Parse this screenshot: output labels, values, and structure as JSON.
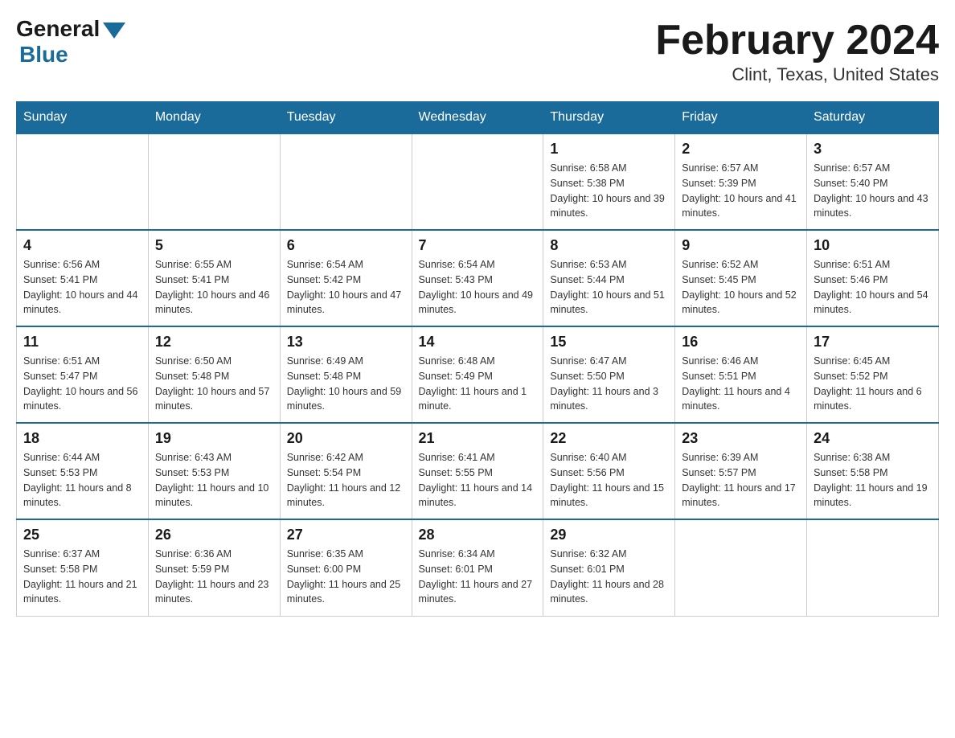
{
  "header": {
    "logo_general": "General",
    "logo_blue": "Blue",
    "month_title": "February 2024",
    "location": "Clint, Texas, United States"
  },
  "days_of_week": [
    "Sunday",
    "Monday",
    "Tuesday",
    "Wednesday",
    "Thursday",
    "Friday",
    "Saturday"
  ],
  "weeks": [
    [
      {
        "day": "",
        "info": ""
      },
      {
        "day": "",
        "info": ""
      },
      {
        "day": "",
        "info": ""
      },
      {
        "day": "",
        "info": ""
      },
      {
        "day": "1",
        "info": "Sunrise: 6:58 AM\nSunset: 5:38 PM\nDaylight: 10 hours and 39 minutes."
      },
      {
        "day": "2",
        "info": "Sunrise: 6:57 AM\nSunset: 5:39 PM\nDaylight: 10 hours and 41 minutes."
      },
      {
        "day": "3",
        "info": "Sunrise: 6:57 AM\nSunset: 5:40 PM\nDaylight: 10 hours and 43 minutes."
      }
    ],
    [
      {
        "day": "4",
        "info": "Sunrise: 6:56 AM\nSunset: 5:41 PM\nDaylight: 10 hours and 44 minutes."
      },
      {
        "day": "5",
        "info": "Sunrise: 6:55 AM\nSunset: 5:41 PM\nDaylight: 10 hours and 46 minutes."
      },
      {
        "day": "6",
        "info": "Sunrise: 6:54 AM\nSunset: 5:42 PM\nDaylight: 10 hours and 47 minutes."
      },
      {
        "day": "7",
        "info": "Sunrise: 6:54 AM\nSunset: 5:43 PM\nDaylight: 10 hours and 49 minutes."
      },
      {
        "day": "8",
        "info": "Sunrise: 6:53 AM\nSunset: 5:44 PM\nDaylight: 10 hours and 51 minutes."
      },
      {
        "day": "9",
        "info": "Sunrise: 6:52 AM\nSunset: 5:45 PM\nDaylight: 10 hours and 52 minutes."
      },
      {
        "day": "10",
        "info": "Sunrise: 6:51 AM\nSunset: 5:46 PM\nDaylight: 10 hours and 54 minutes."
      }
    ],
    [
      {
        "day": "11",
        "info": "Sunrise: 6:51 AM\nSunset: 5:47 PM\nDaylight: 10 hours and 56 minutes."
      },
      {
        "day": "12",
        "info": "Sunrise: 6:50 AM\nSunset: 5:48 PM\nDaylight: 10 hours and 57 minutes."
      },
      {
        "day": "13",
        "info": "Sunrise: 6:49 AM\nSunset: 5:48 PM\nDaylight: 10 hours and 59 minutes."
      },
      {
        "day": "14",
        "info": "Sunrise: 6:48 AM\nSunset: 5:49 PM\nDaylight: 11 hours and 1 minute."
      },
      {
        "day": "15",
        "info": "Sunrise: 6:47 AM\nSunset: 5:50 PM\nDaylight: 11 hours and 3 minutes."
      },
      {
        "day": "16",
        "info": "Sunrise: 6:46 AM\nSunset: 5:51 PM\nDaylight: 11 hours and 4 minutes."
      },
      {
        "day": "17",
        "info": "Sunrise: 6:45 AM\nSunset: 5:52 PM\nDaylight: 11 hours and 6 minutes."
      }
    ],
    [
      {
        "day": "18",
        "info": "Sunrise: 6:44 AM\nSunset: 5:53 PM\nDaylight: 11 hours and 8 minutes."
      },
      {
        "day": "19",
        "info": "Sunrise: 6:43 AM\nSunset: 5:53 PM\nDaylight: 11 hours and 10 minutes."
      },
      {
        "day": "20",
        "info": "Sunrise: 6:42 AM\nSunset: 5:54 PM\nDaylight: 11 hours and 12 minutes."
      },
      {
        "day": "21",
        "info": "Sunrise: 6:41 AM\nSunset: 5:55 PM\nDaylight: 11 hours and 14 minutes."
      },
      {
        "day": "22",
        "info": "Sunrise: 6:40 AM\nSunset: 5:56 PM\nDaylight: 11 hours and 15 minutes."
      },
      {
        "day": "23",
        "info": "Sunrise: 6:39 AM\nSunset: 5:57 PM\nDaylight: 11 hours and 17 minutes."
      },
      {
        "day": "24",
        "info": "Sunrise: 6:38 AM\nSunset: 5:58 PM\nDaylight: 11 hours and 19 minutes."
      }
    ],
    [
      {
        "day": "25",
        "info": "Sunrise: 6:37 AM\nSunset: 5:58 PM\nDaylight: 11 hours and 21 minutes."
      },
      {
        "day": "26",
        "info": "Sunrise: 6:36 AM\nSunset: 5:59 PM\nDaylight: 11 hours and 23 minutes."
      },
      {
        "day": "27",
        "info": "Sunrise: 6:35 AM\nSunset: 6:00 PM\nDaylight: 11 hours and 25 minutes."
      },
      {
        "day": "28",
        "info": "Sunrise: 6:34 AM\nSunset: 6:01 PM\nDaylight: 11 hours and 27 minutes."
      },
      {
        "day": "29",
        "info": "Sunrise: 6:32 AM\nSunset: 6:01 PM\nDaylight: 11 hours and 28 minutes."
      },
      {
        "day": "",
        "info": ""
      },
      {
        "day": "",
        "info": ""
      }
    ]
  ]
}
